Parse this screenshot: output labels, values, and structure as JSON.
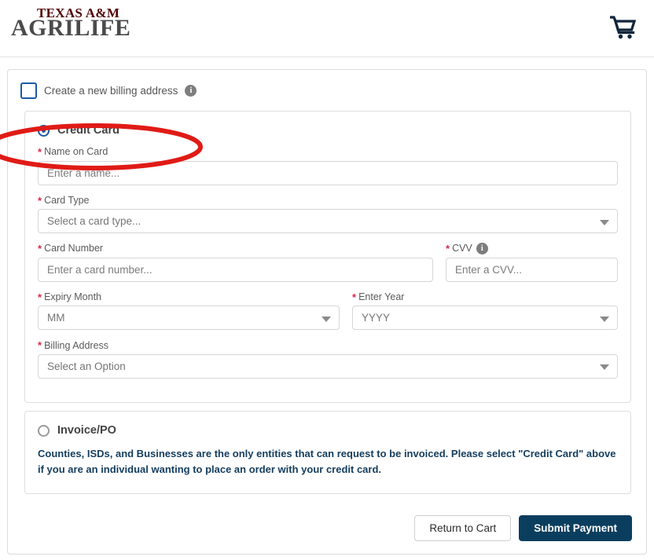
{
  "header": {
    "logo": {
      "line1": "TEXAS A&M",
      "line2": "AGRILIFE",
      "maroon": "#500000",
      "gray": "#4b4b4b"
    },
    "cart_icon": "shopping-cart-icon"
  },
  "billing": {
    "create_new_label": "Create a new billing address",
    "info_icon": "info-icon",
    "checked": false
  },
  "annotation": {
    "shape": "ellipse",
    "color": "#e01b16"
  },
  "payment_methods": {
    "credit_card": {
      "label": "Credit Card",
      "selected": true,
      "fields": {
        "name_on_card": {
          "label": "Name on Card",
          "required": true,
          "placeholder": "Enter a name...",
          "value": ""
        },
        "card_type": {
          "label": "Card Type",
          "required": true,
          "placeholder": "Select a card type...",
          "value": "Select a card type..."
        },
        "card_number": {
          "label": "Card Number",
          "required": true,
          "placeholder": "Enter a card number...",
          "value": ""
        },
        "cvv": {
          "label": "CVV",
          "required": true,
          "info_icon": "info-icon",
          "placeholder": "Enter a CVV...",
          "value": ""
        },
        "expiry_month": {
          "label": "Expiry Month",
          "required": true,
          "placeholder": "MM",
          "value": "MM"
        },
        "expiry_year": {
          "label": "Enter Year",
          "required": true,
          "placeholder": "YYYY",
          "value": "YYYY"
        },
        "billing_address": {
          "label": "Billing Address",
          "required": true,
          "placeholder": "Select an Option",
          "value": "Select an Option"
        }
      }
    },
    "invoice_po": {
      "label": "Invoice/PO",
      "selected": false,
      "note": "Counties, ISDs, and Businesses are the only entities that can request to be invoiced. Please select \"Credit Card\" above if you are an individual wanting to place an order with your credit card."
    }
  },
  "actions": {
    "return_to_cart": "Return to Cart",
    "submit_payment": "Submit Payment"
  },
  "colors": {
    "primary_navy": "#0b3e5e",
    "accent_blue": "#1a5ba6",
    "required_red": "#d8294c",
    "annotation_red": "#e01b16",
    "note_navy": "#143d5e"
  }
}
